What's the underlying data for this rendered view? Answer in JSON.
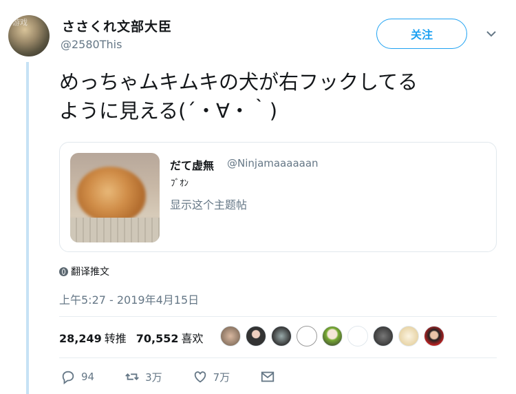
{
  "user": {
    "display_name": "ささくれ文部大臣",
    "handle": "@2580This",
    "watermark": "游戏"
  },
  "header": {
    "follow_label": "关注"
  },
  "tweet": {
    "text_line1": "めっちゃムキムキの犬が右フックしてる",
    "text_line2": "ように見える(´・∀・｀)"
  },
  "quote": {
    "name": "だて虚無",
    "handle": "@Ninjamaaaaaan",
    "text": "ﾌﾞｵﾝ",
    "show_thread": "显示这个主题帖"
  },
  "translate_label": "翻译推文",
  "timestamp": "上午5:27 - 2019年4月15日",
  "stats": {
    "retweets_count": "28,249",
    "retweets_label": "转推",
    "likes_count": "70,552",
    "likes_label": "喜欢"
  },
  "liker_avatars": [
    "avatar-1",
    "avatar-2",
    "avatar-3",
    "avatar-4",
    "avatar-5",
    "avatar-6",
    "avatar-7",
    "avatar-8",
    "avatar-9"
  ],
  "actions": {
    "reply_count": "94",
    "retweet_count": "3万",
    "like_count": "7万"
  },
  "colors": {
    "accent": "#1da1f2",
    "thread": "#c6e2f5",
    "muted": "#657786"
  }
}
